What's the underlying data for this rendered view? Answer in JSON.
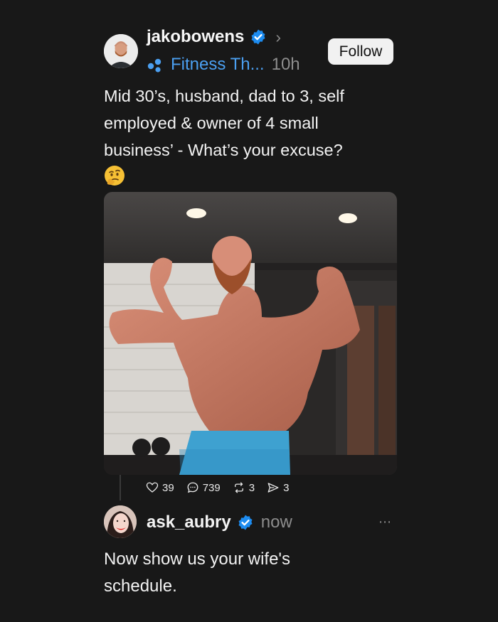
{
  "post": {
    "username": "jakobowens",
    "community": "Fitness Th...",
    "time": "10h",
    "follow_label": "Follow",
    "text": "Mid 30’s, husband, dad to 3, self\nemployed & owner of 4 small\nbusiness’ - What’s your excuse?",
    "emoji": "thinking-face-icon",
    "stats": {
      "likes": "39",
      "comments": "739",
      "reposts": "3",
      "shares": "3"
    }
  },
  "reply": {
    "username": "ask_aubry",
    "time": "now",
    "text": "Now show us your wife's\nschedule."
  },
  "colors": {
    "background": "#181818",
    "verified_blue": "#1d8cf0",
    "community_blue": "#4b9ff0"
  }
}
